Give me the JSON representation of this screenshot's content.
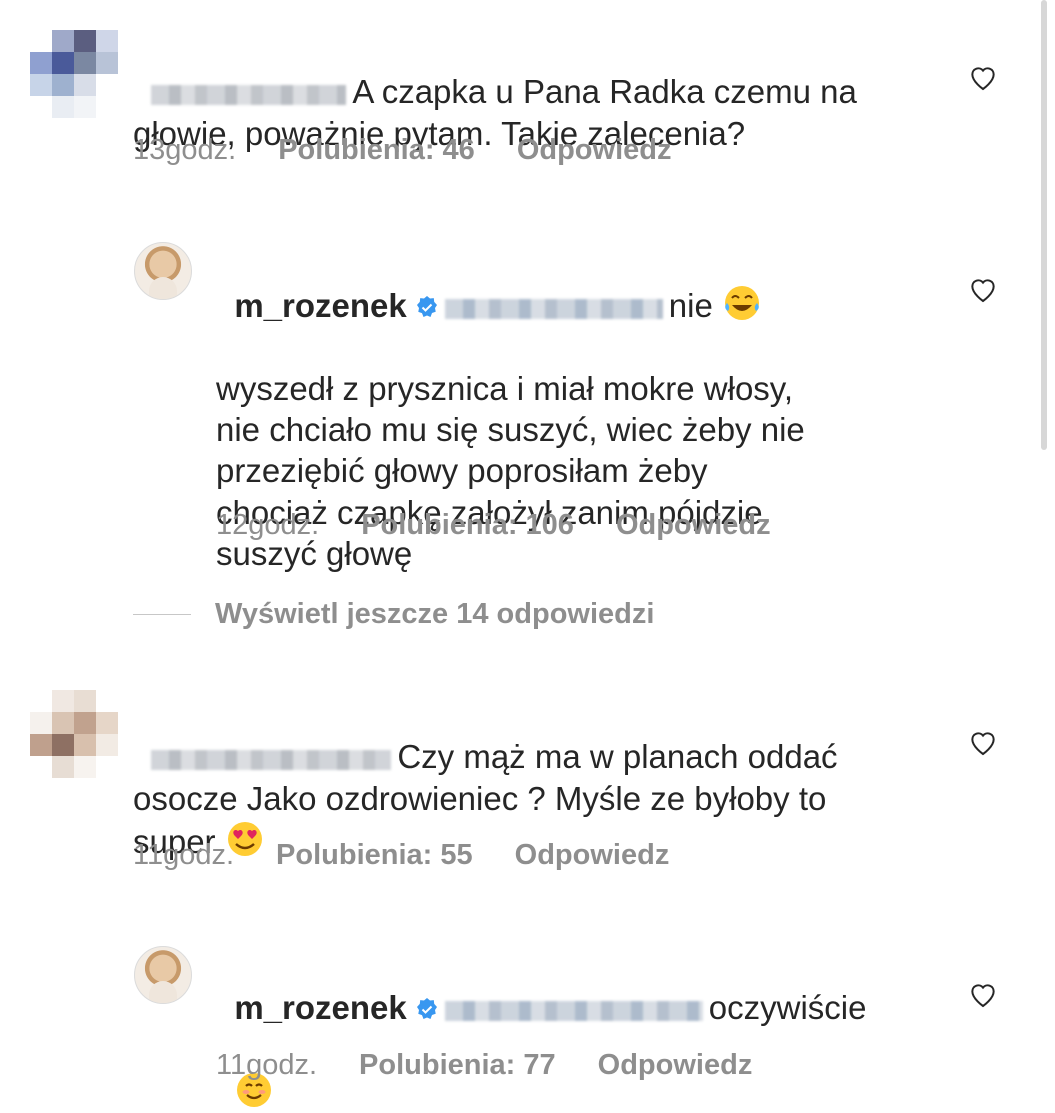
{
  "comments": [
    {
      "text": "A czapka u Pana Radka czemu na\ngłowie, poważnie pytam. Takie zalecenia?",
      "time": "13godz.",
      "likes": "Polubienia: 46",
      "reply": "Odpowiedz"
    },
    {
      "username": "m_rozenek",
      "text_start": "nie",
      "text_rest": "wyszedł z prysznica i miał mokre włosy,\nnie chciało mu się suszyć, wiec żeby nie\nprzeziębić głowy poprosiłam żeby\nchociaż czapkę założył zanim pójdzie\nsuszyć głowę",
      "time": "12godz.",
      "likes": "Polubienia: 106",
      "reply": "Odpowiedz"
    },
    {
      "text": "Czy mąż ma w planach oddać\nosocze Jako ozdrowieniec ? Myśle ze byłoby to\nsuper",
      "time": "11godz.",
      "likes": "Polubienia: 55",
      "reply": "Odpowiedz"
    },
    {
      "username": "m_rozenek",
      "text_start": "oczywiście",
      "time": "11godz.",
      "likes": "Polubienia: 77",
      "reply": "Odpowiedz"
    }
  ],
  "view_more": "Wyświetl jeszcze 14 odpowiedzi",
  "colors": {
    "text": "#262626",
    "muted": "#8e8e8e",
    "verified": "#3897f0"
  }
}
